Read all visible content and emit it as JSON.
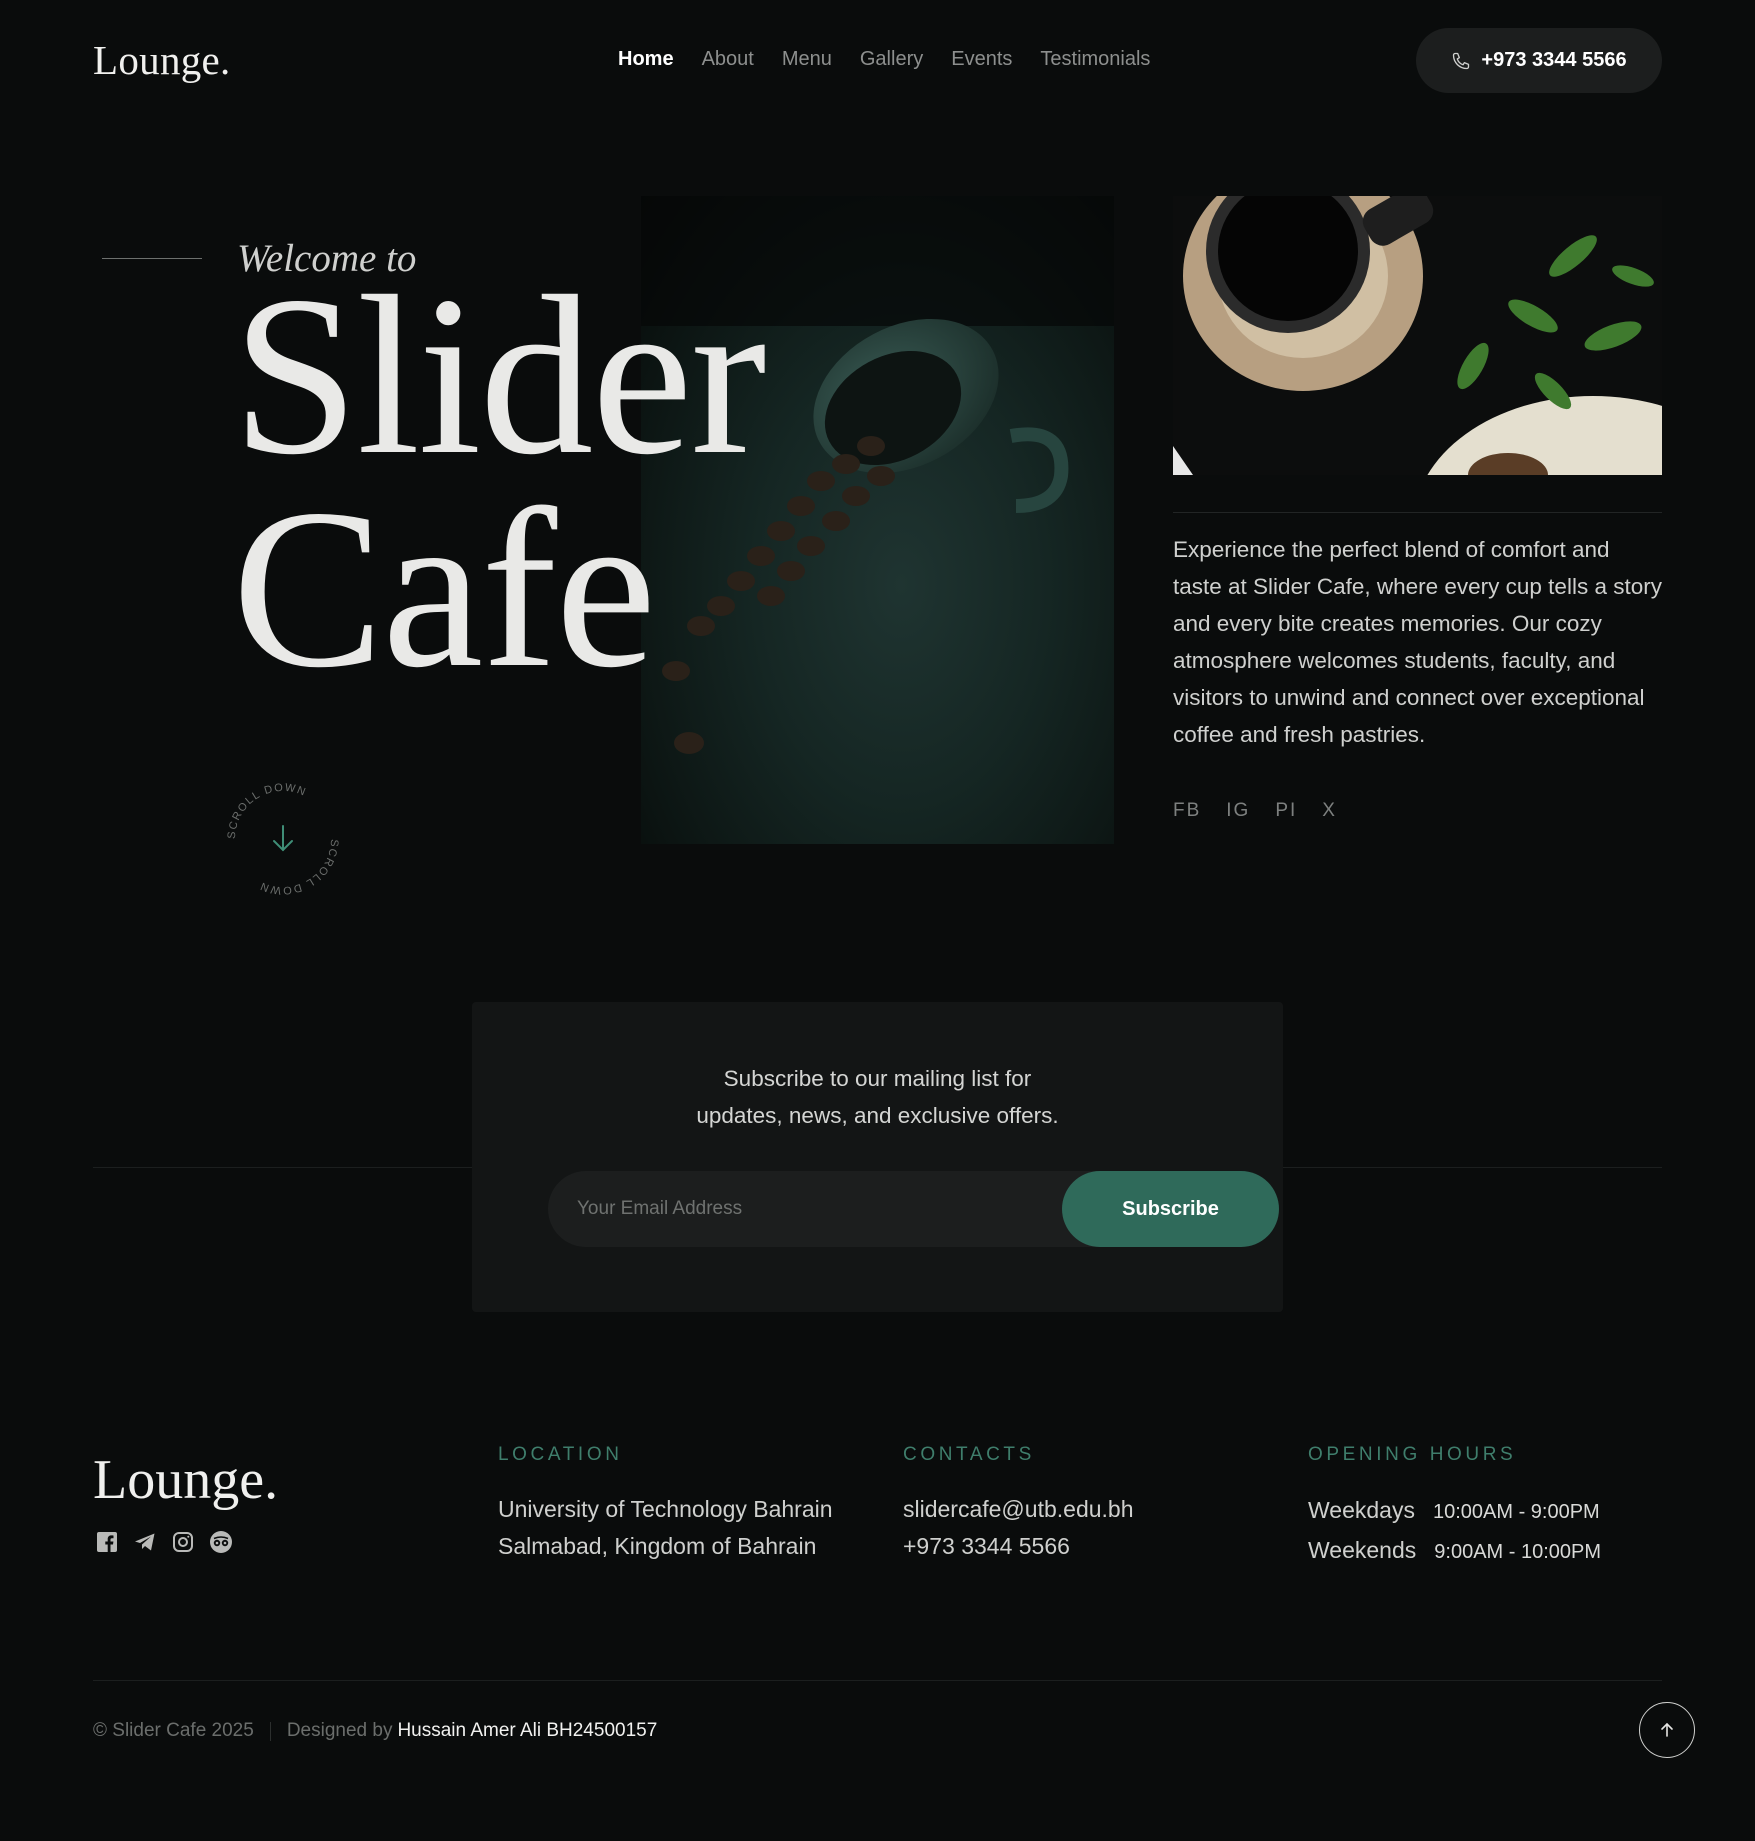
{
  "header": {
    "logo": "Lounge.",
    "nav": [
      {
        "label": "Home",
        "active": true
      },
      {
        "label": "About",
        "active": false
      },
      {
        "label": "Menu",
        "active": false
      },
      {
        "label": "Gallery",
        "active": false
      },
      {
        "label": "Events",
        "active": false
      },
      {
        "label": "Testimonials",
        "active": false
      }
    ],
    "phone": "+973 3344 5566",
    "phone_icon": "phone-icon"
  },
  "hero": {
    "welcome": "Welcome to",
    "title_line1": "Slider",
    "title_line2": "Cafe",
    "scroll_text": "SCROLL DOWN",
    "scroll_icon": "arrow-down-icon",
    "description": "Experience the perfect blend of comfort and taste at Slider Cafe, where every cup tells a story and every bite creates memories. Our cozy atmosphere welcomes students, faculty, and visitors to unwind and connect over exceptional coffee and fresh pastries.",
    "socials": [
      "FB",
      "IG",
      "PI",
      "X"
    ]
  },
  "newsletter": {
    "line1": "Subscribe to our mailing list for",
    "line2": "updates, news, and exclusive offers.",
    "placeholder": "Your Email Address",
    "button": "Subscribe"
  },
  "footer": {
    "logo": "Lounge.",
    "icons": [
      "facebook-icon",
      "telegram-icon",
      "instagram-icon",
      "tripadvisor-icon"
    ],
    "location": {
      "heading": "LOCATION",
      "line1": "University of Technology Bahrain",
      "line2": "Salmabad, Kingdom of Bahrain"
    },
    "contacts": {
      "heading": "CONTACTS",
      "email": "slidercafe@utb.edu.bh",
      "phone": "+973 3344 5566"
    },
    "hours": {
      "heading": "OPENING HOURS",
      "rows": [
        {
          "day": "Weekdays",
          "time": "10:00AM - 9:00PM"
        },
        {
          "day": "Weekends",
          "time": "9:00AM - 10:00PM"
        }
      ]
    },
    "copyright": "© Slider Cafe 2025",
    "designed_by": "Designed by",
    "author": "Hussain Amer Ali BH24500157",
    "to_top_icon": "arrow-up-icon"
  },
  "colors": {
    "background": "#0a0c0c",
    "accent": "#2f6a5a",
    "accent_text": "#3f7e6c",
    "panel": "#131515"
  }
}
